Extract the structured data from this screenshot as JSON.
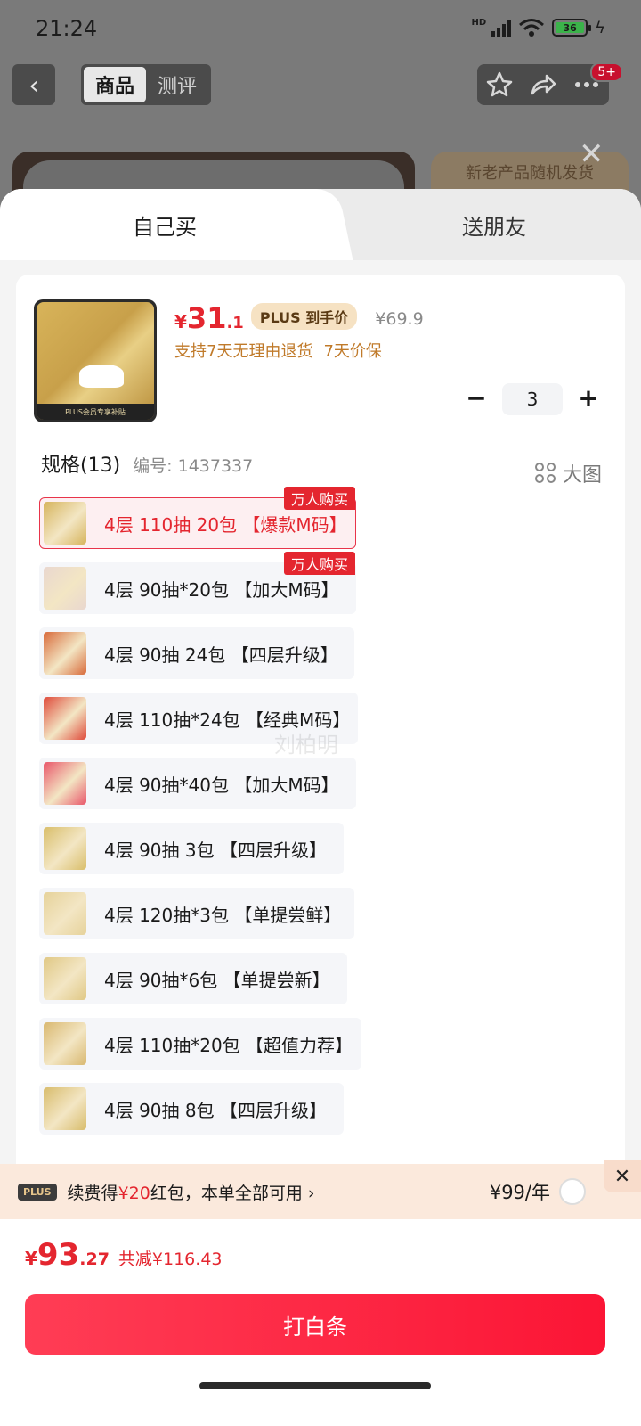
{
  "status_bar": {
    "time": "21:24",
    "network": "HD",
    "battery": "36"
  },
  "nav": {
    "tabs": [
      "商品",
      "测评"
    ],
    "badge": "5+"
  },
  "background": {
    "banner_text": "新老产品随机发货"
  },
  "sheet": {
    "tabs": {
      "self": "自己买",
      "friend": "送朋友"
    },
    "product": {
      "thumb_footer": "PLUS会员专享补贴",
      "currency": "¥",
      "price_int": "31",
      "price_dec": ".1",
      "plus_label": "PLUS 到手价",
      "original_price": "¥69.9",
      "promises": [
        "支持7天无理由退货",
        "7天价保"
      ],
      "quantity": "3",
      "minus": "−",
      "plus": "+"
    },
    "spec": {
      "title": "规格(13)",
      "code": "编号: 1437337",
      "big_image": "大图",
      "hot_tag": "万人购买",
      "items": [
        {
          "label": "4层 110抽 20包 【爆款M码】",
          "hot": true,
          "selected": true,
          "color": "#d6b45c"
        },
        {
          "label": "4层 90抽*20包 【加大M码】",
          "hot": true,
          "selected": false,
          "color": "#e9d7cf"
        },
        {
          "label": "4层 90抽 24包 【四层升级】",
          "hot": false,
          "selected": false,
          "color": "#d86a3a"
        },
        {
          "label": "4层 110抽*24包 【经典M码】",
          "hot": false,
          "selected": false,
          "color": "#df4a3a"
        },
        {
          "label": "4层 90抽*40包 【加大M码】",
          "hot": false,
          "selected": false,
          "color": "#e9566a"
        },
        {
          "label": "4层 90抽 3包 【四层升级】",
          "hot": false,
          "selected": false,
          "color": "#d9be6a"
        },
        {
          "label": "4层 120抽*3包 【单提尝鲜】",
          "hot": false,
          "selected": false,
          "color": "#e6d29a"
        },
        {
          "label": "4层 90抽*6包 【单提尝新】",
          "hot": false,
          "selected": false,
          "color": "#e0c885"
        },
        {
          "label": "4层 110抽*20包 【超值力荐】",
          "hot": false,
          "selected": false,
          "color": "#d9b870"
        },
        {
          "label": "4层 90抽 8包 【四层升级】",
          "hot": false,
          "selected": false,
          "color": "#d8bc6c"
        }
      ],
      "watermark": "刘柏明"
    }
  },
  "plus_bar": {
    "logo": "PLUS",
    "text_prefix": "续费得",
    "amount": "¥20",
    "text_suffix": "红包，本单全部可用 ›",
    "fee": "¥99/年",
    "close": "✕"
  },
  "footer": {
    "currency": "¥",
    "total_int": "93",
    "total_dec": ".27",
    "saved": "共减¥116.43",
    "pay_button": "打白条"
  }
}
